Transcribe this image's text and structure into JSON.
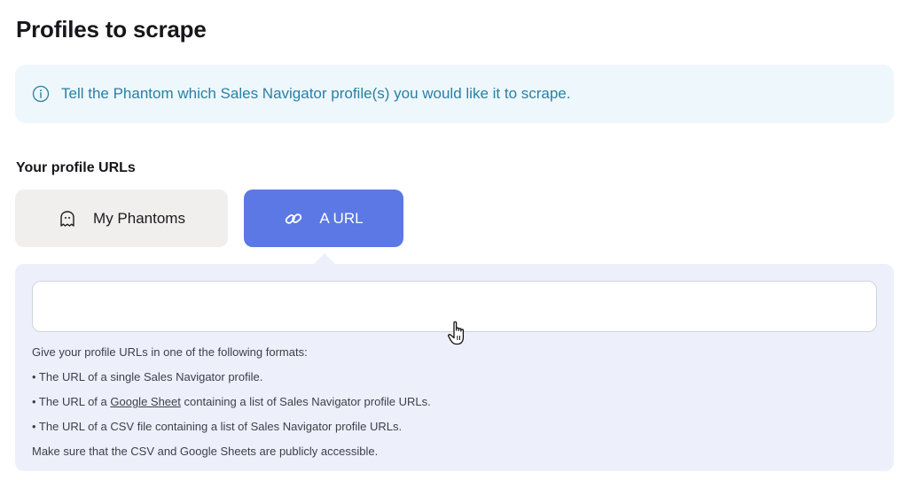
{
  "page": {
    "title": "Profiles to scrape"
  },
  "info_banner": {
    "icon": "info-icon",
    "text": "Tell the Phantom which Sales Navigator profile(s) you would like it to scrape."
  },
  "profile_urls": {
    "label": "Your profile URLs",
    "tabs": [
      {
        "label": "My Phantoms",
        "icon": "ghost-icon",
        "selected": false
      },
      {
        "label": "A URL",
        "icon": "link-icon",
        "selected": true
      }
    ],
    "input": {
      "value": "",
      "placeholder": ""
    },
    "help": {
      "intro": "Give your profile URLs in one of the following formats:",
      "line1": "• The URL of a single Sales Navigator profile.",
      "line2_prefix": "• The URL of a ",
      "line2_link": "Google Sheet",
      "line2_suffix": " containing a list of Sales Navigator profile URLs.",
      "line3": "• The URL of a CSV file containing a list of Sales Navigator profile URLs.",
      "note": "Make sure that the CSV and Google Sheets are publicly accessible."
    }
  },
  "colors": {
    "accent": "#5b78e4",
    "info_text": "#2a7fa5",
    "info_bg": "#eef7fb",
    "panel_bg": "#edf0fb"
  },
  "cursor": "hand-pointer-icon"
}
